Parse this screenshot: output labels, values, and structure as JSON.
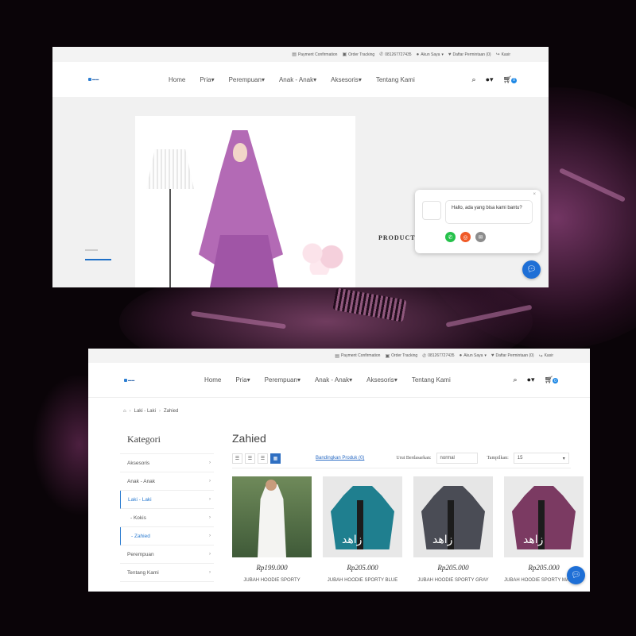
{
  "topbar": {
    "payment": "Payment Confirmation",
    "order_tracking": "Order Tracking",
    "phone": "081267727435",
    "account": "Akun Saya",
    "wishlist": "Daftar Permintaan (0)",
    "checkout": "Kasir"
  },
  "nav": {
    "home": "Home",
    "pria": "Pria",
    "perempuan": "Perempuan",
    "anak": "Anak - Anak",
    "aksesoris": "Aksesoris",
    "tentang": "Tentang Kami",
    "cart_count": "0"
  },
  "hero": {
    "product_text": "PRODUCT"
  },
  "chat": {
    "message": "Hallo, ada yang bisa kami bantu?"
  },
  "breadcrumb": [
    "Laki - Laki",
    "Zahied"
  ],
  "sidebar": {
    "title": "Kategori",
    "items": [
      {
        "label": "Aksesoris"
      },
      {
        "label": "Anak - Anak"
      },
      {
        "label": "Laki - Laki"
      },
      {
        "label": "- Kokis"
      },
      {
        "label": "- Zahied"
      },
      {
        "label": "Perempuan"
      },
      {
        "label": "Tentang Kami"
      }
    ]
  },
  "category": {
    "title": "Zahied",
    "compare": "Bandingkan Produk (0)",
    "sort_label": "Urut Berdasarkan:",
    "sort_value": "normal",
    "show_label": "Tampilkan:",
    "show_value": "15"
  },
  "products": [
    {
      "price": "Rp199.000",
      "name": "JUBAH HOODIE SPORTY",
      "color": "#5a7a4a"
    },
    {
      "price": "Rp205.000",
      "name": "JUBAH HOODIE SPORTY BLUE",
      "color": "#1f7f8f"
    },
    {
      "price": "Rp205.000",
      "name": "JUBAH HOODIE SPORTY GRAY",
      "color": "#4a4c55"
    },
    {
      "price": "Rp205.000",
      "name": "JUBAH HOODIE SPORTY MAROON",
      "color": "#7b3a62"
    }
  ],
  "colors": {
    "accent": "#1e6fd6",
    "hijab": "#b36ab5"
  }
}
